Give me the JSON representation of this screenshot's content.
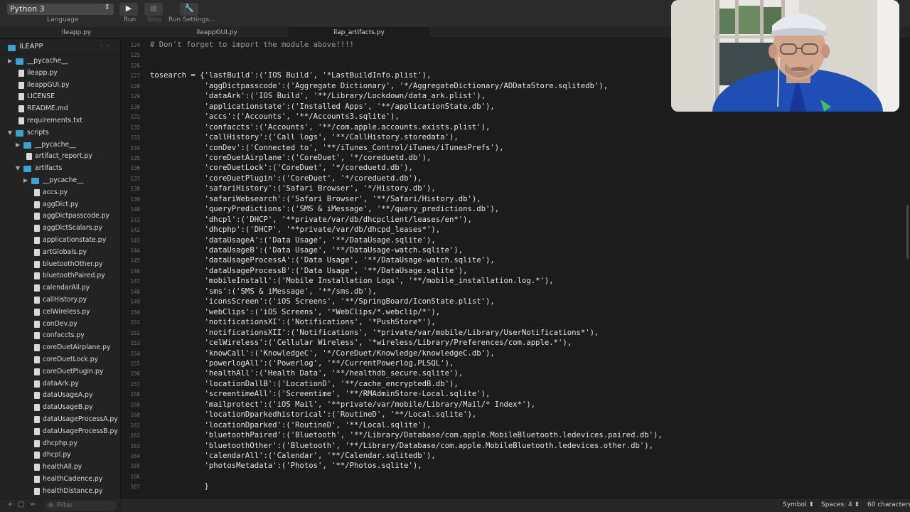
{
  "toolbar": {
    "language": "Python 3",
    "language_caption": "Language",
    "run_label": "Run",
    "stop_label": "Stop",
    "settings_label": "Run Settings..."
  },
  "tabs": [
    {
      "label": "ileapp.py"
    },
    {
      "label": "ileappGUI.py"
    },
    {
      "label": "ilap_artifacts.py"
    }
  ],
  "sidebar": {
    "title": "iLEAPP",
    "items": [
      {
        "label": "__pycache__"
      },
      {
        "label": "ileapp.py"
      },
      {
        "label": "ileappGUI.py"
      },
      {
        "label": "LICENSE"
      },
      {
        "label": "README.md"
      },
      {
        "label": "requirements.txt"
      },
      {
        "label": "scripts"
      },
      {
        "label": "__pycache__"
      },
      {
        "label": "artifact_report.py"
      },
      {
        "label": "artifacts"
      },
      {
        "label": "__pycache__"
      },
      {
        "label": "accs.py"
      },
      {
        "label": "aggDict.py"
      },
      {
        "label": "aggDictpasscode.py"
      },
      {
        "label": "aggDictScalars.py"
      },
      {
        "label": "applicationstate.py"
      },
      {
        "label": "artGlobals.py"
      },
      {
        "label": "bluetoothOther.py"
      },
      {
        "label": "bluetoothPaired.py"
      },
      {
        "label": "calendarAll.py"
      },
      {
        "label": "callHistory.py"
      },
      {
        "label": "celWireless.py"
      },
      {
        "label": "conDev.py"
      },
      {
        "label": "confaccts.py"
      },
      {
        "label": "coreDuetAirplane.py"
      },
      {
        "label": "coreDuetLock.py"
      },
      {
        "label": "coreDuetPlugin.py"
      },
      {
        "label": "dataArk.py"
      },
      {
        "label": "dataUsageA.py"
      },
      {
        "label": "dataUsageB.py"
      },
      {
        "label": "dataUsageProcessA.py"
      },
      {
        "label": "dataUsageProcessB.py"
      },
      {
        "label": "dhcphp.py"
      },
      {
        "label": "dhcpl.py"
      },
      {
        "label": "healthAll.py"
      },
      {
        "label": "healthCadence.py"
      },
      {
        "label": "healthDistance.py"
      }
    ],
    "filter_placeholder": "Filter"
  },
  "editor": {
    "lines": [
      {
        "num": "124",
        "text": "# Don't forget to import the module above!!!!"
      },
      {
        "num": "125",
        "text": ""
      },
      {
        "num": "126",
        "text": ""
      },
      {
        "num": "127",
        "text": "tosearch = {'lastBuild':('IOS Build', '*LastBuildInfo.plist'),"
      },
      {
        "num": "128",
        "text": "            'aggDictpasscode':('Aggregate Dictionary', '*/AggregateDictionary/ADDataStore.sqlitedb'),"
      },
      {
        "num": "129",
        "text": "            'dataArk':('IOS Build', '**/Library/Lockdown/data_ark.plist'),"
      },
      {
        "num": "130",
        "text": "            'applicationstate':('Installed Apps', '**/applicationState.db'),"
      },
      {
        "num": "131",
        "text": "            'accs':('Accounts', '**/Accounts3.sqlite'),"
      },
      {
        "num": "132",
        "text": "            'confaccts':('Accounts', '**/com.apple.accounts.exists.plist'),"
      },
      {
        "num": "133",
        "text": "            'callHistory':('Call logs', '**/CallHistory.storedata'),"
      },
      {
        "num": "134",
        "text": "            'conDev':('Connected to', '**/iTunes_Control/iTunes/iTunesPrefs'),"
      },
      {
        "num": "135",
        "text": "            'coreDuetAirplane':('CoreDuet', '*/coreduetd.db'),"
      },
      {
        "num": "136",
        "text": "            'coreDuetLock':('CoreDuet', '*/coreduetd.db'),"
      },
      {
        "num": "137",
        "text": "            'coreDuetPlugin':('CoreDuet', '*/coreduetd.db'),"
      },
      {
        "num": "138",
        "text": "            'safariHistory':('Safari Browser', '*/History.db'),"
      },
      {
        "num": "139",
        "text": "            'safariWebsearch':('Safari Browser', '**/Safari/History.db'),"
      },
      {
        "num": "140",
        "text": "            'queryPredictions':('SMS & iMessage', '**/query_predictions.db'),"
      },
      {
        "num": "141",
        "text": "            'dhcpl':('DHCP', '**private/var/db/dhcpclient/leases/en*'),"
      },
      {
        "num": "142",
        "text": "            'dhcphp':('DHCP', '**private/var/db/dhcpd_leases*'),"
      },
      {
        "num": "143",
        "text": "            'dataUsageA':('Data Usage', '**/DataUsage.sqlite'),"
      },
      {
        "num": "144",
        "text": "            'dataUsageB':('Data Usage', '**/DataUsage-watch.sqlite'),"
      },
      {
        "num": "145",
        "text": "            'dataUsageProcessA':('Data Usage', '**/DataUsage-watch.sqlite'),"
      },
      {
        "num": "146",
        "text": "            'dataUsageProcessB':('Data Usage', '**/DataUsage.sqlite'),"
      },
      {
        "num": "147",
        "text": "            'mobileInstall':('Mobile Installation Logs', '**/mobile_installation.log.*'),"
      },
      {
        "num": "148",
        "text": "            'sms':('SMS & iMessage', '**/sms.db'),"
      },
      {
        "num": "149",
        "text": "            'iconsScreen':('iOS Screens', '**/SpringBoard/IconState.plist'),"
      },
      {
        "num": "150",
        "text": "            'webClips':('iOS Screens', '*WebClips/*.webclip/*'),"
      },
      {
        "num": "151",
        "text": "            'notificationsXI':('Notifications', '*PushStore*'),"
      },
      {
        "num": "152",
        "text": "            'notificationsXII':('Notifications', '*private/var/mobile/Library/UserNotifications*'),"
      },
      {
        "num": "153",
        "text": "            'celWireless':('Cellular Wireless', '*wireless/Library/Preferences/com.apple.*'),"
      },
      {
        "num": "154",
        "text": "            'knowCall':('KnowledgeC', '*/CoreDuet/Knowledge/knowledgeC.db'),"
      },
      {
        "num": "155",
        "text": "            'powerlogAll':('Powerlog', '**/CurrentPowerlog.PLSQL'),"
      },
      {
        "num": "156",
        "text": "            'healthAll':('Health Data', '**/healthdb_secure.sqlite'),"
      },
      {
        "num": "157",
        "text": "            'locationDallB':('LocationD', '**/cache_encryptedB.db'),"
      },
      {
        "num": "158",
        "text": "            'screentimeAll':('Screentime', '**/RMAdminStore-Local.sqlite'),"
      },
      {
        "num": "159",
        "text": "            'mailprotect':('iOS Mail', '**private/var/mobile/Library/Mail/* Index*'),"
      },
      {
        "num": "160",
        "text": "            'locationDparkedhistorical':('RoutineD', '**/Local.sqlite'),"
      },
      {
        "num": "161",
        "text": "            'locationDparked':('RoutineD', '**/Local.sqlite'),"
      },
      {
        "num": "162",
        "text": "            'bluetoothPaired':('Bluetooth', '**/Library/Database/com.apple.MobileBluetooth.ledevices.paired.db'),"
      },
      {
        "num": "163",
        "text": "            'bluetoothOther':('Bluetooth', '**/Library/Database/com.apple.MobileBluetooth.ledevices.other.db'),"
      },
      {
        "num": "164",
        "text": "            'calendarAll':('Calendar', '**/Calendar.sqlitedb'),"
      },
      {
        "num": "165",
        "text": "            'photosMetadata':('Photos', '**/Photos.sqlite'),"
      },
      {
        "num": "166",
        "text": ""
      },
      {
        "num": "167",
        "text": "            }"
      }
    ]
  },
  "statusbar": {
    "symbol": "Symbol ⬍",
    "spaces": "Spaces: 4 ⬍",
    "characters": "60 characters"
  },
  "icons": {
    "run": "play-icon",
    "stop": "stop-icon",
    "settings": "wrench-icon"
  },
  "colors": {
    "folder": "#3aa3d4",
    "comment": "#9a9a9a"
  }
}
